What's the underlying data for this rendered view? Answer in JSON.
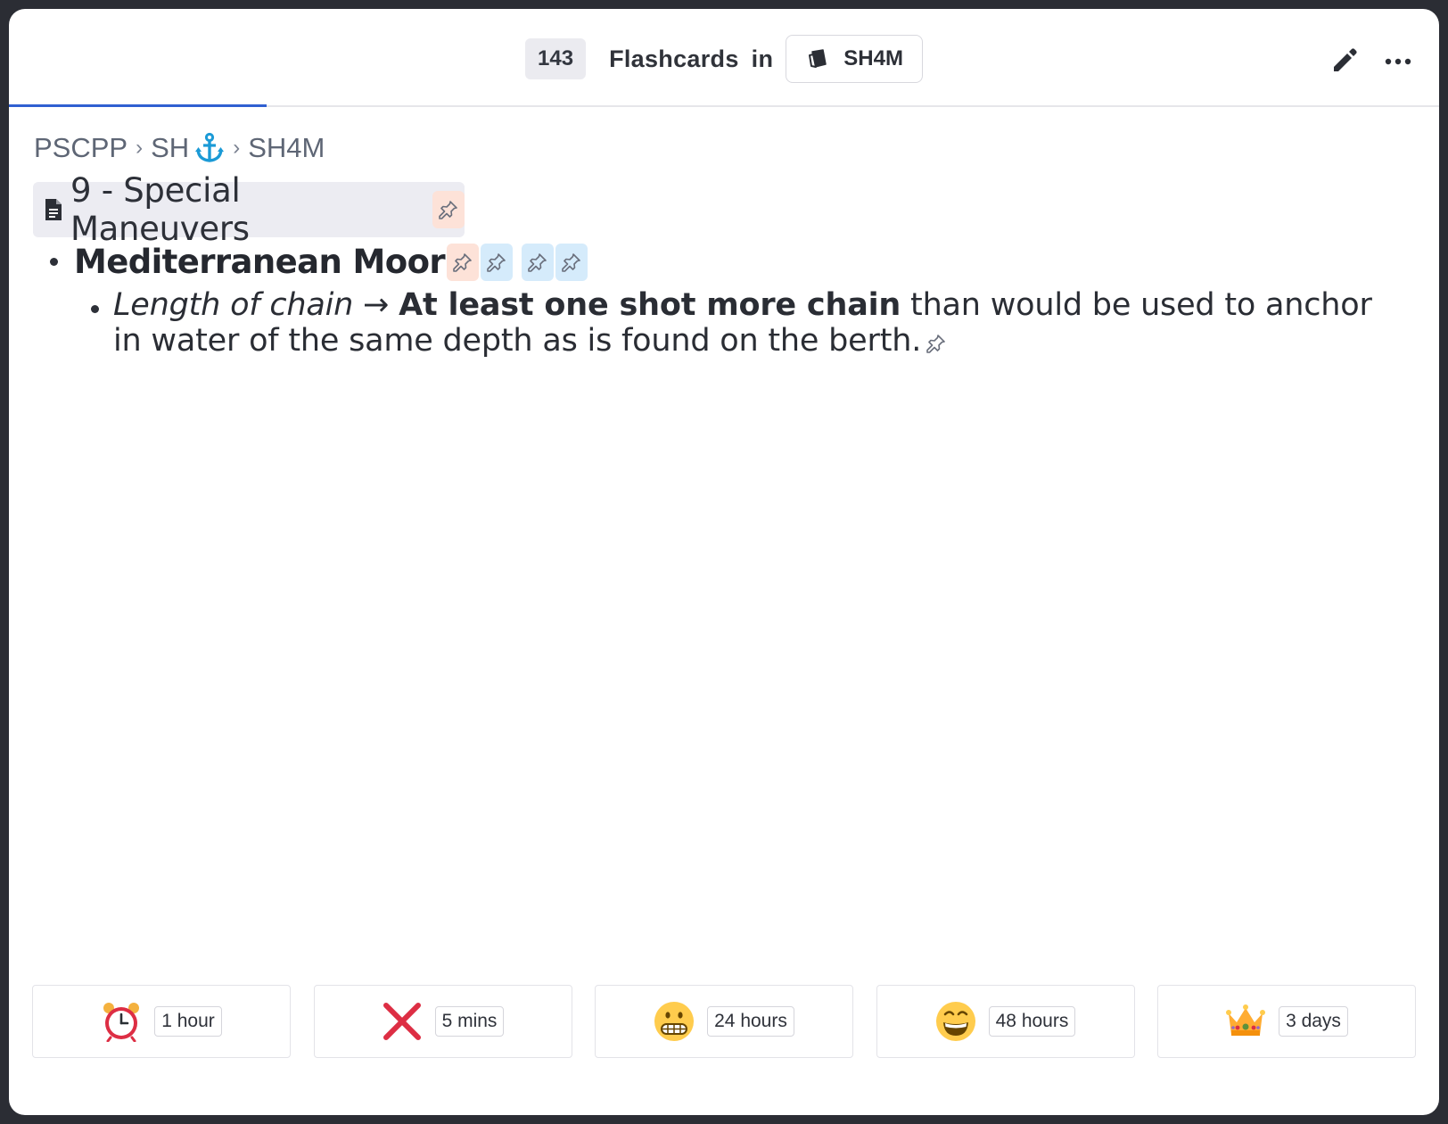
{
  "header": {
    "count": "143",
    "word_flashcards": "Flashcards",
    "word_in": "in",
    "deck_label": "SH4M",
    "progress_fraction": 0.18,
    "icons": {
      "deck": "deck-cards-icon",
      "edit": "pencil-icon",
      "more": "more-dots-icon"
    }
  },
  "breadcrumb": {
    "items": [
      "PSCPP",
      "SH",
      "SH4M"
    ],
    "separator": "›",
    "anchor_icon": "anchor-icon",
    "anchor_color": "#1b9ad6"
  },
  "document": {
    "title": "9 - Special Maneuvers",
    "icon": "document-icon"
  },
  "card": {
    "front": "Mediterranean Moor",
    "term": "Length of chain",
    "arrow": "→",
    "answer_bold": "At least one shot more chain",
    "answer_rest": " than would be used to anchor in water of the same depth as is found on the berth."
  },
  "colors": {
    "accent": "#2f5fd1",
    "pin_orange_bg": "#fde2d8",
    "pin_blue_bg": "#d5ebfb",
    "title_bg": "#ececf2"
  },
  "ratings": [
    {
      "icon": "alarm-clock-icon",
      "interval": "1 hour"
    },
    {
      "icon": "cross-mark-icon",
      "interval": "5 mins"
    },
    {
      "icon": "grimacing-face-icon",
      "interval": "24 hours"
    },
    {
      "icon": "grinning-squinting-face-icon",
      "interval": "48 hours"
    },
    {
      "icon": "crown-icon",
      "interval": "3 days"
    }
  ]
}
